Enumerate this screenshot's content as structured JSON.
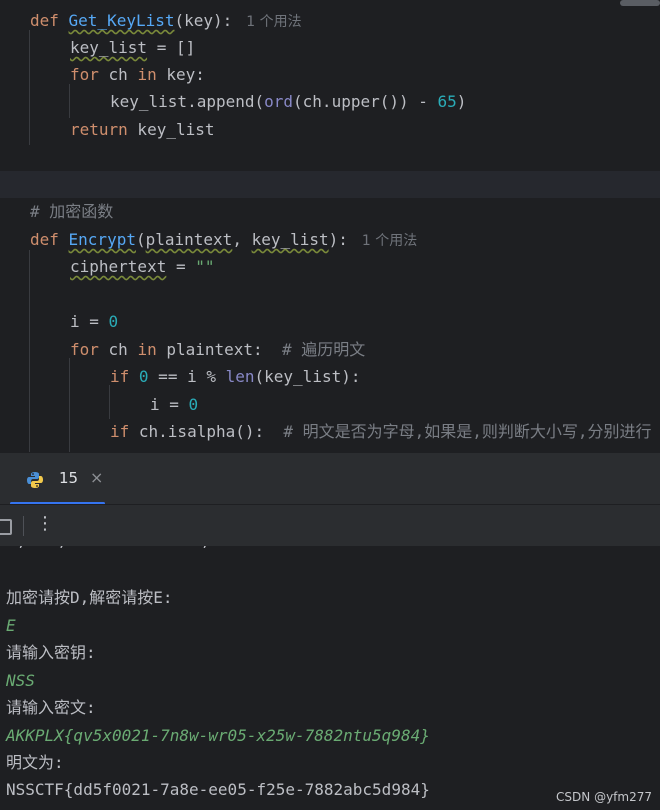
{
  "editor": {
    "lines": [
      {
        "text_def": "def ",
        "name": "Get_KeyList",
        "args": "(key):",
        "hint": "1 个用法"
      },
      {
        "a": "key_list",
        "b": " = []"
      },
      {
        "a": "for",
        "b": " ch ",
        "c": "in",
        "d": " key:"
      },
      {
        "a": "key_list.append(",
        "b": "ord",
        "c": "(ch.upper()) - ",
        "d": "65",
        "e": ")"
      },
      {
        "a": "return",
        "b": " key_list"
      },
      {
        "comment": "# 加密函数"
      },
      {
        "text_def": "def ",
        "name": "Encrypt",
        "args_a": "(",
        "arg1": "plaintext",
        "args_b": ", ",
        "arg2": "key_list",
        "args_c": "):",
        "hint": "1 个用法"
      },
      {
        "a": "ciphertext",
        "b": " = ",
        "c": "\"\""
      },
      {
        "a": "i = ",
        "b": "0"
      },
      {
        "a": "for",
        "b": " ch ",
        "c": "in",
        "d": " plaintext:  ",
        "e": "# 遍历明文"
      },
      {
        "a": "if",
        "b": " ",
        "c": "0",
        "d": " == i % ",
        "e": "len",
        "f": "(key_list):"
      },
      {
        "a": "i = ",
        "b": "0"
      },
      {
        "a": "if",
        "b": " ch.isalpha():  ",
        "c": "# 明文是否为字母,如果是,则判断大小写,分别进行"
      }
    ]
  },
  "run_panel": {
    "tab_label": "15",
    "tab_close": "×",
    "kebab": "⋮"
  },
  "console": {
    "cut_text": "‥,‥ ‥,‥ ‥ ‥ ‥ ‥‥‥ ‥,‥ ‥ ‥‥‥ ‥ ‥‥‥",
    "lines": [
      {
        "text": "加密请按D,解密请按E:",
        "kind": "out"
      },
      {
        "text": "E",
        "kind": "in"
      },
      {
        "text": "请输入密钥:",
        "kind": "out"
      },
      {
        "text": "NSS",
        "kind": "in"
      },
      {
        "text": "请输入密文:",
        "kind": "out"
      },
      {
        "text": "AKKPLX{qv5x0021-7n8w-wr05-x25w-7882ntu5q984}",
        "kind": "in"
      },
      {
        "text": "明文为:",
        "kind": "out"
      },
      {
        "text": "NSSCTF{dd5f0021-7a8e-ee05-f25e-7882abc5d984}",
        "kind": "out"
      }
    ]
  },
  "watermark": "CSDN @yfm277",
  "colors": {
    "background": "#1e1f22",
    "keyword": "#cf8e6d",
    "function": "#56a8f5",
    "number": "#2aacb8",
    "string_input": "#6aab73",
    "comment": "#7a7e85",
    "accent": "#3574f0"
  },
  "icons": [
    "python-icon",
    "close-icon",
    "stop-icon",
    "more-options-icon"
  ]
}
